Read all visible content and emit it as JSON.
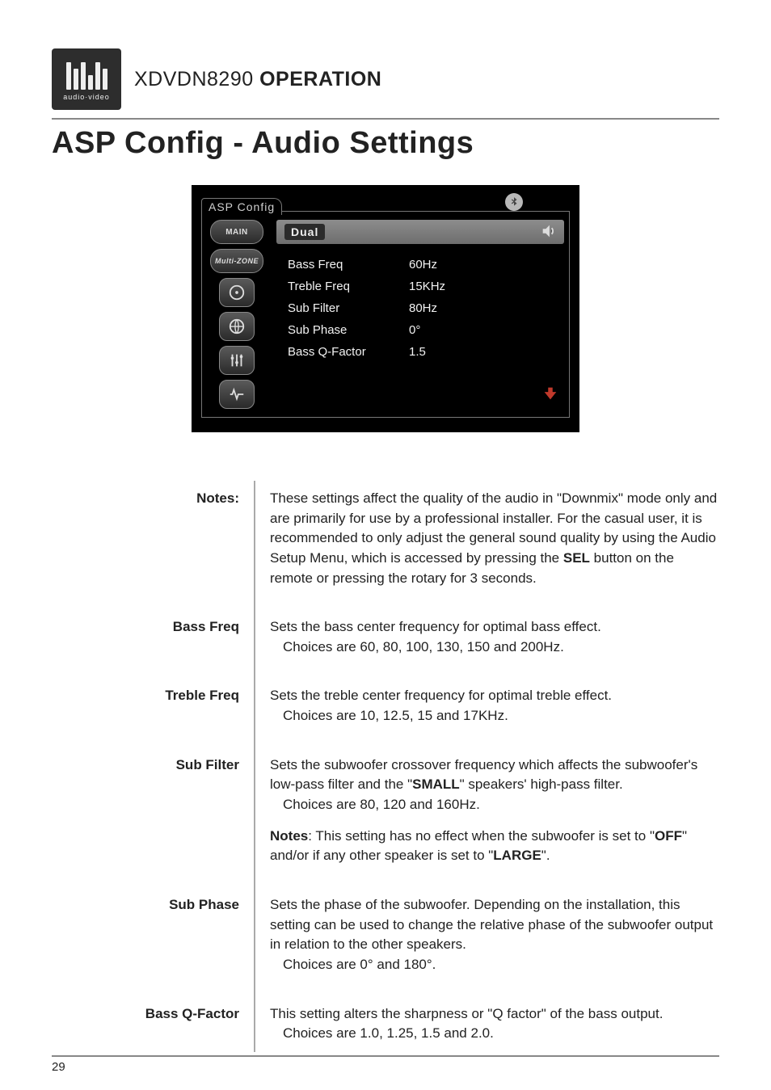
{
  "logo_sub": "audio·video",
  "header_model": "XDVDN8290",
  "header_operation": "OPERATION",
  "section_title": "ASP Config - Audio Settings",
  "screenshot": {
    "tab_label": "ASP Config",
    "sidebar": {
      "main": "MAIN",
      "multizone": "Multi-ZONE"
    },
    "brand": "Dual",
    "rows": [
      {
        "label": "Bass Freq",
        "value": "60Hz"
      },
      {
        "label": "Treble Freq",
        "value": "15KHz"
      },
      {
        "label": "Sub Filter",
        "value": "80Hz"
      },
      {
        "label": "Sub Phase",
        "value": "0°"
      },
      {
        "label": "Bass Q-Factor",
        "value": "1.5"
      }
    ]
  },
  "defs": {
    "notes_label": "Notes:",
    "notes_body_a": "These settings affect the quality of the audio in \"Downmix\" mode only and are primarily for use by a professional installer. For the casual user, it is recommended to only adjust the general sound quality by using the Audio Setup Menu, which is accessed by pressing the ",
    "notes_body_sel": "SEL",
    "notes_body_b": " button on the remote or pressing the rotary for 3 seconds.",
    "bass_freq_label": "Bass Freq",
    "bass_freq_body": "Sets the bass center frequency for optimal bass effect.",
    "bass_freq_choices": "Choices are 60, 80, 100, 130, 150 and 200Hz.",
    "treble_freq_label": "Treble Freq",
    "treble_freq_body": "Sets the treble center frequency for optimal treble effect.",
    "treble_freq_choices": "Choices are 10, 12.5, 15 and 17KHz.",
    "sub_filter_label": "Sub Filter",
    "sub_filter_body_a": "Sets the subwoofer crossover frequency which affects the subwoofer's low-pass filter and the \"",
    "sub_filter_small": "SMALL",
    "sub_filter_body_b": "\" speakers' high-pass filter.",
    "sub_filter_choices": "Choices are 80, 120 and 160Hz.",
    "sub_filter_note_a": "Notes",
    "sub_filter_note_b": ": This setting has no effect when the subwoofer is set to \"",
    "sub_filter_off": "OFF",
    "sub_filter_note_c": "\" and/or if any other speaker is set to \"",
    "sub_filter_large": "LARGE",
    "sub_filter_note_d": "\".",
    "sub_phase_label": "Sub Phase",
    "sub_phase_body": "Sets the phase of the subwoofer. Depending on the installation, this setting can be used to change the relative phase of the subwoofer output in relation to the other speakers.",
    "sub_phase_choices": "Choices are 0° and 180°.",
    "bass_q_label": "Bass Q-Factor",
    "bass_q_body": "This setting alters the sharpness or \"Q factor\" of the bass output.",
    "bass_q_choices": "Choices are 1.0, 1.25, 1.5 and 2.0."
  },
  "page_number": "29"
}
